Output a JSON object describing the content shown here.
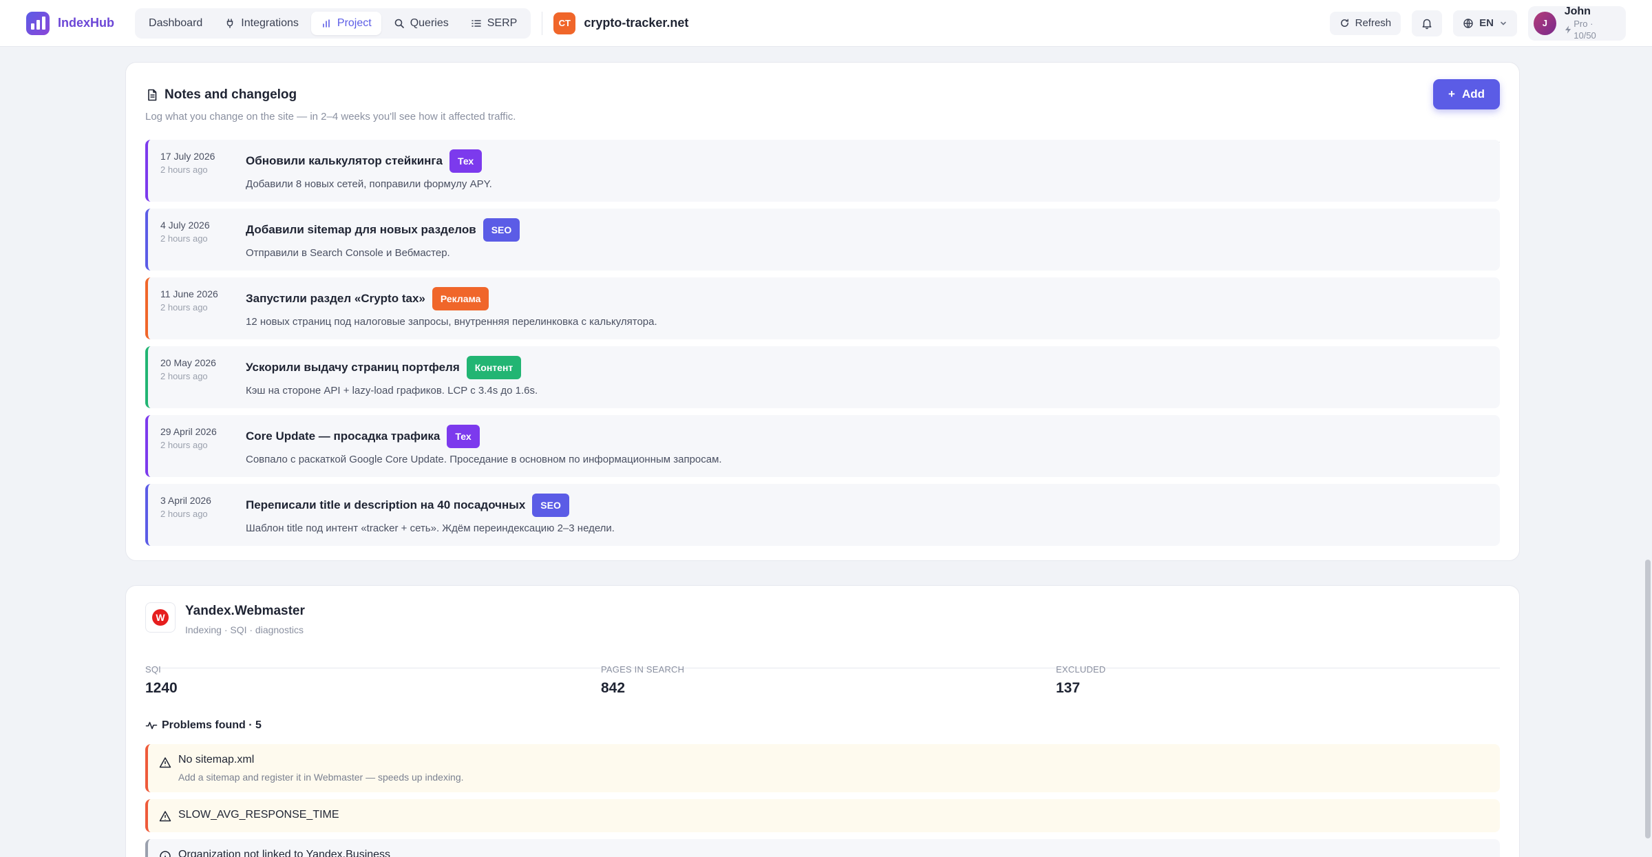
{
  "app": {
    "name": "IndexHub"
  },
  "nav": [
    {
      "label": "Dashboard",
      "icon": "none"
    },
    {
      "label": "Integrations",
      "icon": "plug-icon"
    },
    {
      "label": "Project",
      "icon": "bar-chart-icon",
      "active": true
    },
    {
      "label": "Queries",
      "icon": "search-icon"
    },
    {
      "label": "SERP",
      "icon": "list-icon"
    }
  ],
  "site": {
    "badge": "CT",
    "name": "crypto-tracker.net",
    "badge_color": "#f0662a"
  },
  "topbar": {
    "refresh_label": "Refresh",
    "lang": "EN"
  },
  "user": {
    "initial": "J",
    "name": "John",
    "plan": "Pro · 10/50"
  },
  "notes": {
    "title": "Notes and changelog",
    "subtitle": "Log what you change on the site — in 2–4 weeks you'll see how it affected traffic.",
    "add_label": "Add",
    "items": [
      {
        "date": "17 July 2026",
        "ago": "2 hours ago",
        "title": "Обновили калькулятор стейкинга",
        "tag": "Тех",
        "tag_color": "#7c3aed",
        "desc": "Добавили 8 новых сетей, поправили формулу APY."
      },
      {
        "date": "4 July 2026",
        "ago": "2 hours ago",
        "title": "Добавили sitemap для новых разделов",
        "tag": "SEO",
        "tag_color": "#5b5ce6",
        "desc": "Отправили в Search Console и Вебмастер."
      },
      {
        "date": "11 June 2026",
        "ago": "2 hours ago",
        "title": "Запустили раздел «Crypto tax»",
        "tag": "Реклама",
        "tag_color": "#f0662a",
        "desc": "12 новых страниц под налоговые запросы, внутренняя перелинковка с калькулятора."
      },
      {
        "date": "20 May 2026",
        "ago": "2 hours ago",
        "title": "Ускорили выдачу страниц портфеля",
        "tag": "Контент",
        "tag_color": "#22b573",
        "desc": "Кэш на стороне API + lazy-load графиков. LCP с 3.4s до 1.6s."
      },
      {
        "date": "29 April 2026",
        "ago": "2 hours ago",
        "title": "Core Update — просадка трафика",
        "tag": "Тех",
        "tag_color": "#7c3aed",
        "desc": "Совпало с раскаткой Google Core Update. Проседание в основном по информационным запросам."
      },
      {
        "date": "3 April 2026",
        "ago": "2 hours ago",
        "title": "Переписали title и description на 40 посадочных",
        "tag": "SEO",
        "tag_color": "#5b5ce6",
        "desc": "Шаблон title под интент «tracker + сеть». Ждём переиндексацию 2–3 недели."
      }
    ]
  },
  "webmaster": {
    "logo": "W",
    "title": "Yandex.Webmaster",
    "subtitle": "Indexing · SQI · diagnostics",
    "metrics": [
      {
        "label": "SQI",
        "value": "1240"
      },
      {
        "label": "PAGES IN SEARCH",
        "value": "842"
      },
      {
        "label": "EXCLUDED",
        "value": "137"
      }
    ],
    "problems_title": "Problems found · 5",
    "problems": [
      {
        "title": "No sitemap.xml",
        "desc": "Add a sitemap and register it in Webmaster — speeds up indexing."
      },
      {
        "title": "SLOW_AVG_RESPONSE_TIME",
        "desc": ""
      },
      {
        "title": "Organization not linked to Yandex.Business",
        "desc": ""
      }
    ]
  }
}
